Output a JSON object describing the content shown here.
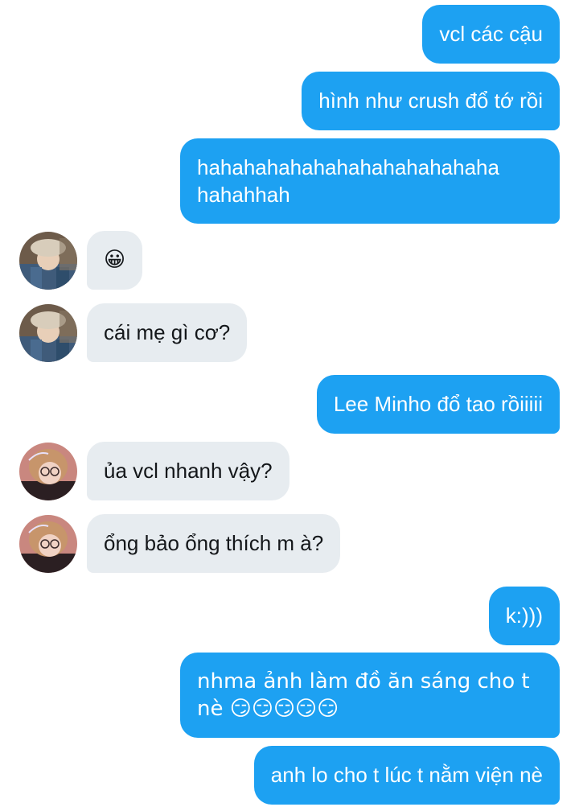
{
  "messages": [
    {
      "side": "out",
      "text": "vcl các cậu"
    },
    {
      "side": "out",
      "text": "hình như crush đổ tớ rồi"
    },
    {
      "side": "out",
      "text": "hahahahahahahahahahahahaha\nhahahhah"
    },
    {
      "side": "in",
      "avatar": "avatar-user-beret",
      "text": "😀"
    },
    {
      "side": "in",
      "avatar": "avatar-user-beret",
      "text": "cái mẹ gì cơ?"
    },
    {
      "side": "out",
      "text": "Lee Minho đổ tao rồiiiii"
    },
    {
      "side": "in",
      "avatar": "avatar-user-glasses",
      "text": "ủa vcl nhanh vậy?"
    },
    {
      "side": "in",
      "avatar": "avatar-user-glasses",
      "text": "ổng bảo ổng thích m à?"
    },
    {
      "side": "out",
      "text": "k:)))"
    },
    {
      "side": "out",
      "text": "nhma ảnh làm đồ ăn sáng cho t\nnè 😏😏😏😏😏"
    },
    {
      "side": "out",
      "text": "anh lo cho t lúc t nằm viện nè"
    }
  ],
  "colors": {
    "outgoing_bubble": "#1da1f2",
    "incoming_bubble": "#e7ecf0"
  }
}
